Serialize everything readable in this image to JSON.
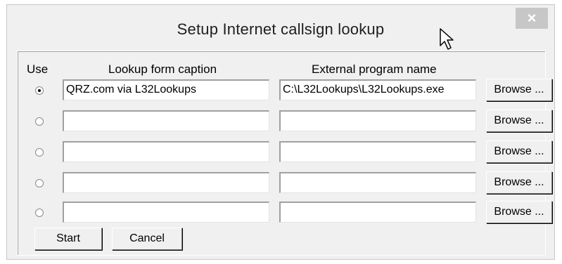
{
  "window": {
    "title": "Setup Internet callsign lookup",
    "close_label": "×"
  },
  "columns": {
    "use": "Use",
    "caption": "Lookup form caption",
    "program": "External program name"
  },
  "rows": [
    {
      "selected": true,
      "caption": "QRZ.com via L32Lookups",
      "program": "C:\\L32Lookups\\L32Lookups.exe",
      "browse_label": "Browse ..."
    },
    {
      "selected": false,
      "caption": "",
      "program": "",
      "browse_label": "Browse ..."
    },
    {
      "selected": false,
      "caption": "",
      "program": "",
      "browse_label": "Browse ..."
    },
    {
      "selected": false,
      "caption": "",
      "program": "",
      "browse_label": "Browse ..."
    },
    {
      "selected": false,
      "caption": "",
      "program": "",
      "browse_label": "Browse ..."
    }
  ],
  "buttons": {
    "start": "Start",
    "cancel": "Cancel"
  },
  "icons": {
    "close": "close-icon",
    "cursor": "mouse-pointer-icon",
    "radio": "radio-button-icon"
  }
}
